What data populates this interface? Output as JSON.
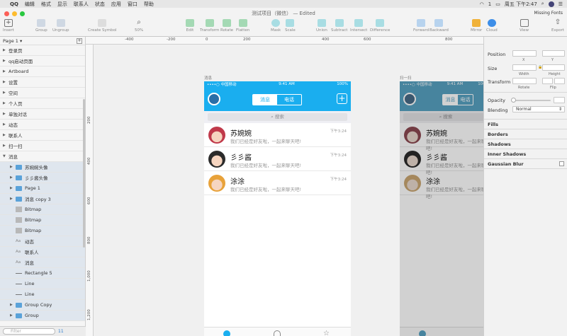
{
  "menubar": {
    "apple": "",
    "app": "QQ",
    "items": [
      "编辑",
      "格式",
      "显示",
      "联系人",
      "状态",
      "应用",
      "窗口",
      "帮助"
    ],
    "clock": "周五 下午2:47",
    "badge": "1"
  },
  "toolbar": {
    "doc_title": "测试项目（微信） — Edited",
    "missing_fonts": "Missing Fonts",
    "zoom": "50%",
    "buttons": [
      {
        "label": "Insert",
        "icon": "insert-icon"
      },
      {
        "label": "Group",
        "icon": "group-icon"
      },
      {
        "label": "Ungroup",
        "icon": "ungroup-icon"
      },
      {
        "label": "Create Symbol",
        "icon": "symbol-icon"
      },
      {
        "label": "Edit",
        "icon": "edit-icon"
      },
      {
        "label": "Transform",
        "icon": "transform-icon"
      },
      {
        "label": "Rotate",
        "icon": "rotate-icon"
      },
      {
        "label": "Flatten",
        "icon": "flatten-icon"
      },
      {
        "label": "Mask",
        "icon": "mask-icon"
      },
      {
        "label": "Scale",
        "icon": "scale-icon"
      },
      {
        "label": "Union",
        "icon": "union-icon"
      },
      {
        "label": "Subtract",
        "icon": "subtract-icon"
      },
      {
        "label": "Intersect",
        "icon": "intersect-icon"
      },
      {
        "label": "Difference",
        "icon": "difference-icon"
      },
      {
        "label": "Forward",
        "icon": "forward-icon"
      },
      {
        "label": "Backward",
        "icon": "backward-icon"
      },
      {
        "label": "Mirror",
        "icon": "mirror-icon"
      },
      {
        "label": "Cloud",
        "icon": "cloud-icon"
      },
      {
        "label": "View",
        "icon": "view-icon"
      },
      {
        "label": "Export",
        "icon": "export-icon"
      }
    ]
  },
  "pages": {
    "current": "Page 1"
  },
  "layers": [
    {
      "label": "登录页",
      "kind": "artboard"
    },
    {
      "label": "qq启动页面",
      "kind": "artboard"
    },
    {
      "label": "Artboard",
      "kind": "artboard"
    },
    {
      "label": "设置",
      "kind": "artboard"
    },
    {
      "label": "空间",
      "kind": "artboard"
    },
    {
      "label": "个人页",
      "kind": "artboard"
    },
    {
      "label": "单独对话",
      "kind": "artboard"
    },
    {
      "label": "动态",
      "kind": "artboard"
    },
    {
      "label": "联系人",
      "kind": "artboard"
    },
    {
      "label": "扫一扫",
      "kind": "artboard"
    },
    {
      "label": "消息",
      "kind": "artboard-open"
    },
    {
      "label": "苏婉婉头像",
      "kind": "group"
    },
    {
      "label": "彡彡酱头像",
      "kind": "group"
    },
    {
      "label": "Page 1",
      "kind": "group"
    },
    {
      "label": "消息 copy 3",
      "kind": "group"
    },
    {
      "label": "Bitmap",
      "kind": "bitmap"
    },
    {
      "label": "Bitmap",
      "kind": "bitmap"
    },
    {
      "label": "Bitmap",
      "kind": "bitmap"
    },
    {
      "label": "动态",
      "kind": "text"
    },
    {
      "label": "联系人",
      "kind": "text"
    },
    {
      "label": "消息",
      "kind": "text"
    },
    {
      "label": "Rectangle 5",
      "kind": "shape"
    },
    {
      "label": "Line",
      "kind": "shape"
    },
    {
      "label": "Line",
      "kind": "shape"
    },
    {
      "label": "Group Copy",
      "kind": "group"
    },
    {
      "label": "Group",
      "kind": "group"
    }
  ],
  "filter": {
    "placeholder": "Filter",
    "count": "11"
  },
  "rulers": {
    "top": [
      "-400",
      "-200",
      "0",
      "200",
      "400",
      "600",
      "800"
    ],
    "left": [
      "200",
      "400",
      "600",
      "800",
      "1,000",
      "1,200"
    ]
  },
  "artboards": {
    "main_title": "消息",
    "second_title": "扫一扫"
  },
  "phone": {
    "carrier": "••••○ 中国移动",
    "time": "9:41 AM",
    "battery": "100%",
    "seg_on": "消息",
    "seg_off": "电话",
    "search": "搜索",
    "chats": [
      {
        "name": "苏婉婉",
        "msg": "我们已经是好友啦，一起来聊天吧!",
        "time": "下午3:24",
        "color": "#c0394a"
      },
      {
        "name": "彡彡酱",
        "msg": "我们已经是好友啦，一起来聊天吧!",
        "time": "下午3:24",
        "color": "#2b2b2b"
      },
      {
        "name": "涂涂",
        "msg": "我们已经是好友啦，一起来聊天吧!",
        "time": "下午3:24",
        "color": "#e8a23a"
      }
    ]
  },
  "inspector": {
    "position": "Position",
    "x": "X",
    "y": "Y",
    "size": "Size",
    "width": "Width",
    "height": "Height",
    "transform": "Transform",
    "rotate": "Rotate",
    "flip": "Flip",
    "opacity": "Opacity",
    "blending": "Blending",
    "blend_mode": "Normal",
    "sections": [
      "Fills",
      "Borders",
      "Shadows",
      "Inner Shadows",
      "Gaussian Blur"
    ]
  },
  "colors": {
    "accent": "#1aaeef",
    "folder": "#5aa2d9",
    "selection": "#dfe6ee"
  }
}
